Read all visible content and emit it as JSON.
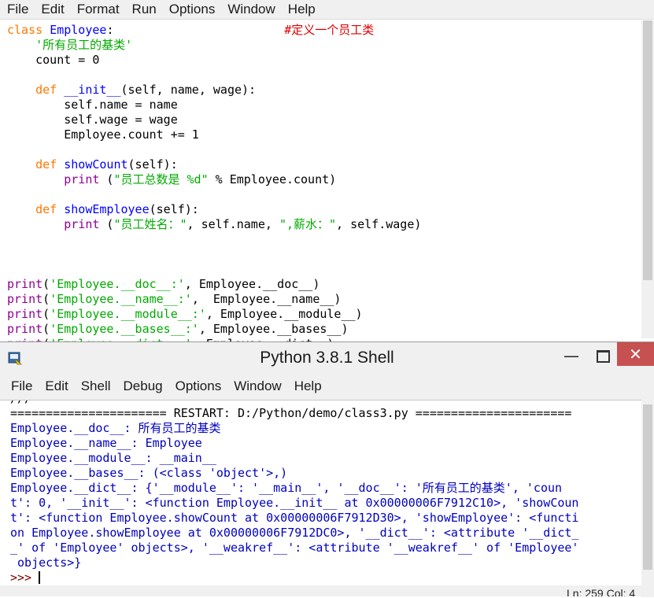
{
  "editor": {
    "menu": [
      "File",
      "Edit",
      "Format",
      "Run",
      "Options",
      "Window",
      "Help"
    ],
    "code": {
      "l1_kw": "class",
      "l1_name": "Employee",
      "l1_rest": ":",
      "l1_comment": "#定义一个员工类",
      "l2": "'所有员工的基类'",
      "l3": "count = 0",
      "l5_kw": "def",
      "l5_name": "__init__",
      "l5_rest": "(self, name, wage):",
      "l6": "self.name = name",
      "l7": "self.wage = wage",
      "l8": "Employee.count += 1",
      "l10_kw": "def",
      "l10_name": "showCount",
      "l10_rest": "(self):",
      "l11_bi": "print",
      "l11_pre": " (",
      "l11_str": "\"员工总数是 %d\"",
      "l11_rest": " % Employee.count)",
      "l13_kw": "def",
      "l13_name": "showEmployee",
      "l13_rest": "(self):",
      "l14_bi": "print",
      "l14_pre": " (",
      "l14_str1": "\"员工姓名：\"",
      "l14_mid": ", self.name, ",
      "l14_str2": "\",薪水：\"",
      "l14_rest": ", self.wage)",
      "p1_bi": "print",
      "p1_str": "'Employee.__doc__:'",
      "p1_rest": ", Employee.__doc__)",
      "p2_bi": "print",
      "p2_str": "'Employee.__name__:'",
      "p2_rest": ",  Employee.__name__)",
      "p3_bi": "print",
      "p3_str": "'Employee.__module__:'",
      "p3_rest": ", Employee.__module__)",
      "p4_bi": "print",
      "p4_str": "'Employee.__bases__:'",
      "p4_rest": ", Employee.__bases__)",
      "p5_bi": "print",
      "p5_str": "'Employee.__dict__:'",
      "p5_rest": ", Employee.__dict__)"
    }
  },
  "shell": {
    "title": "Python 3.8.1 Shell",
    "menu": [
      "File",
      "Edit",
      "Shell",
      "Debug",
      "Options",
      "Window",
      "Help"
    ],
    "minimize": "—",
    "close": "✕",
    "output": [
      "///",
      "====================== RESTART: D:/Python/demo/class3.py ======================",
      "Employee.__doc__: 所有员工的基类",
      "Employee.__name__: Employee",
      "Employee.__module__: __main__",
      "Employee.__bases__: (<class 'object'>,)",
      "Employee.__dict__: {'__module__': '__main__', '__doc__': '所有员工的基类', 'coun",
      "t': 0, '__init__': <function Employee.__init__ at 0x00000006F7912C10>, 'showCoun",
      "t': <function Employee.showCount at 0x00000006F7912D30>, 'showEmployee': <functi",
      "on Employee.showEmployee at 0x00000006F7912DC0>, '__dict__': <attribute '__dict_",
      "_' of 'Employee' objects>, '__weakref__': <attribute '__weakref__' of 'Employee'",
      " objects>}"
    ],
    "prompt": ">>> "
  },
  "status": "Ln: 259  Col: 4"
}
